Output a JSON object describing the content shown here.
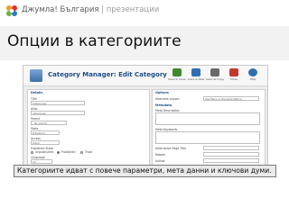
{
  "header": {
    "brand": "Джумла! България",
    "separator": "|",
    "tagline": "презентации"
  },
  "slide": {
    "title": "Опции в категориите",
    "caption": "Категориите идват с повече параметри, мета данни и ключови думи."
  },
  "screenshot": {
    "toolbar": {
      "title": "Category Manager: Edit Category",
      "buttons": [
        {
          "label": "Save & Close",
          "icon": "save-icon",
          "color": "#3f8a2e"
        },
        {
          "label": "Save & New",
          "icon": "save-new-icon",
          "color": "#2f6fb0"
        },
        {
          "label": "Save as Copy",
          "icon": "copy-icon",
          "color": "#6a6a6a"
        },
        {
          "label": "Close",
          "icon": "close-icon",
          "color": "#c0392b"
        },
        {
          "label": "Help",
          "icon": "help-icon",
          "color": "#2f6fb0"
        }
      ]
    },
    "details": {
      "heading": "Details",
      "title_label": "Title",
      "title_value": "Categories",
      "alias_label": "Alias",
      "alias_value": "categories",
      "parent_label": "Parent",
      "parent_value": "- No parent -",
      "state_label": "State",
      "state_value": "Published",
      "access_label": "Access",
      "access_value": "Public",
      "published_label": "Published State",
      "radio_unpublished": "Unpublished",
      "radio_published": "Published",
      "radio_trash": "Trash",
      "language_label": "Language",
      "language_value": "All"
    },
    "options": {
      "heading": "Options",
      "layout_label": "Alternate Layout",
      "layout_value": "Use Menu or Request Setting",
      "metadata_heading": "Metadata",
      "meta_description_label": "Meta Description",
      "meta_keywords_label": "Meta Keywords",
      "page_title_label": "Alternative Page Title",
      "robots_label": "Robots",
      "author_label": "Author"
    },
    "description_label": "Description"
  },
  "colors": {
    "title_band": "#f2f2f2",
    "caption_bg": "#eaeaea",
    "accent": "#1d4f8a"
  }
}
